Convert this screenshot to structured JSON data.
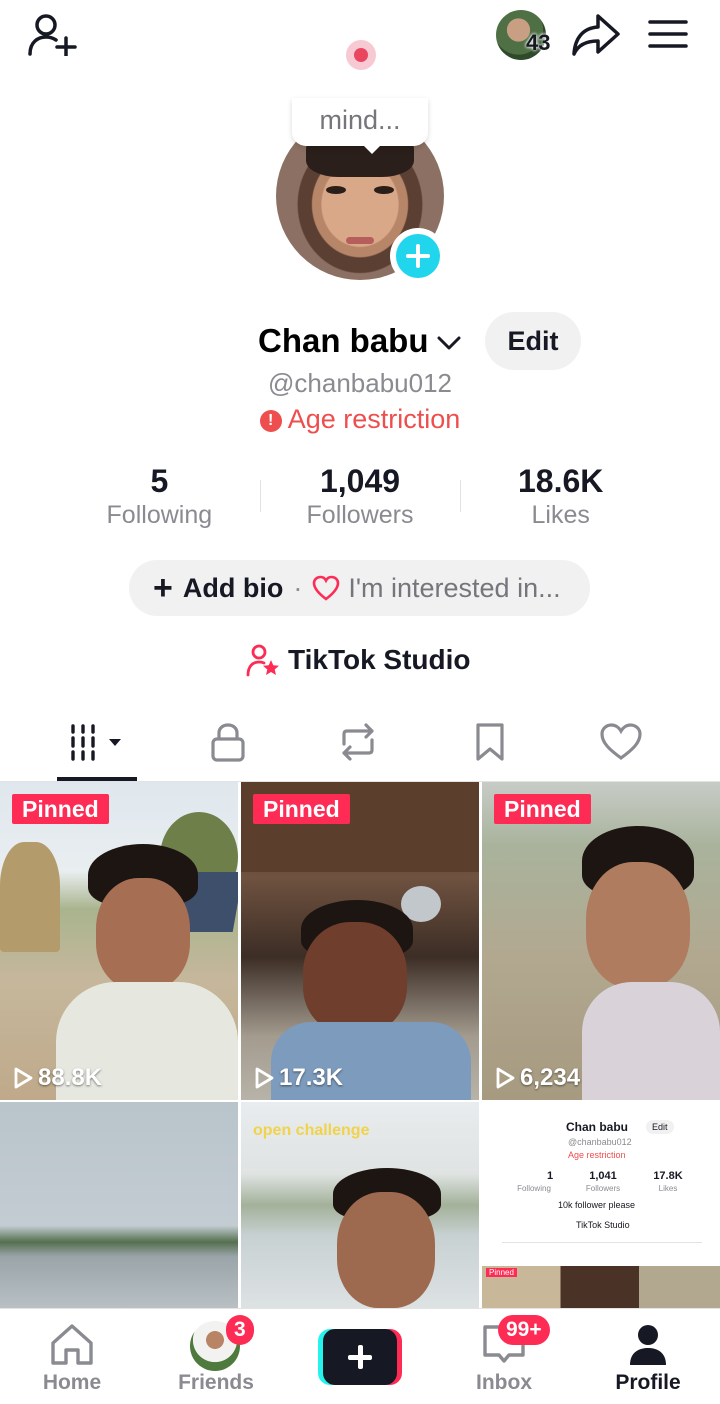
{
  "topbar": {
    "avatar_count": "43"
  },
  "profile": {
    "bubble_text": "mind...",
    "name": "Chan babu",
    "edit_label": "Edit",
    "handle": "@chanbabu012",
    "age_restriction": "Age restriction"
  },
  "stats": [
    {
      "value": "5",
      "label": "Following"
    },
    {
      "value": "1,049",
      "label": "Followers"
    },
    {
      "value": "18.6K",
      "label": "Likes"
    }
  ],
  "bio": {
    "add_bio": "Add bio",
    "separator": "·",
    "interests": "I'm interested in..."
  },
  "studio": {
    "label": "TikTok Studio"
  },
  "tabs": [
    "videos-icon",
    "lock-icon",
    "repost-icon",
    "bookmark-icon",
    "heart-icon"
  ],
  "videos": [
    {
      "pinned": "Pinned",
      "views": "88.8K"
    },
    {
      "pinned": "Pinned",
      "views": "17.3K"
    },
    {
      "pinned": "Pinned",
      "views": "6,234"
    },
    {
      "overlay_text": ""
    },
    {
      "overlay_text": "open challenge"
    },
    {
      "mini": {
        "name": "Chan babu",
        "edit": "Edit",
        "handle": "@chanbabu012",
        "age": "Age restriction",
        "stats": [
          {
            "value": "1",
            "label": "Following"
          },
          {
            "value": "1,041",
            "label": "Followers"
          },
          {
            "value": "17.8K",
            "label": "Likes"
          }
        ],
        "bio": "10k follower please",
        "studio": "TikTok Studio",
        "pinned": "Pinned"
      }
    }
  ],
  "nav": {
    "home": "Home",
    "friends": "Friends",
    "friends_badge": "3",
    "inbox": "Inbox",
    "inbox_badge": "99+",
    "profile": "Profile"
  },
  "colors": {
    "accent": "#fe2c55",
    "cyan": "#25f4ee",
    "text": "#161823",
    "muted": "#8a8b91",
    "warning": "#ee4e4e",
    "plus_badge": "#20d5ec"
  }
}
